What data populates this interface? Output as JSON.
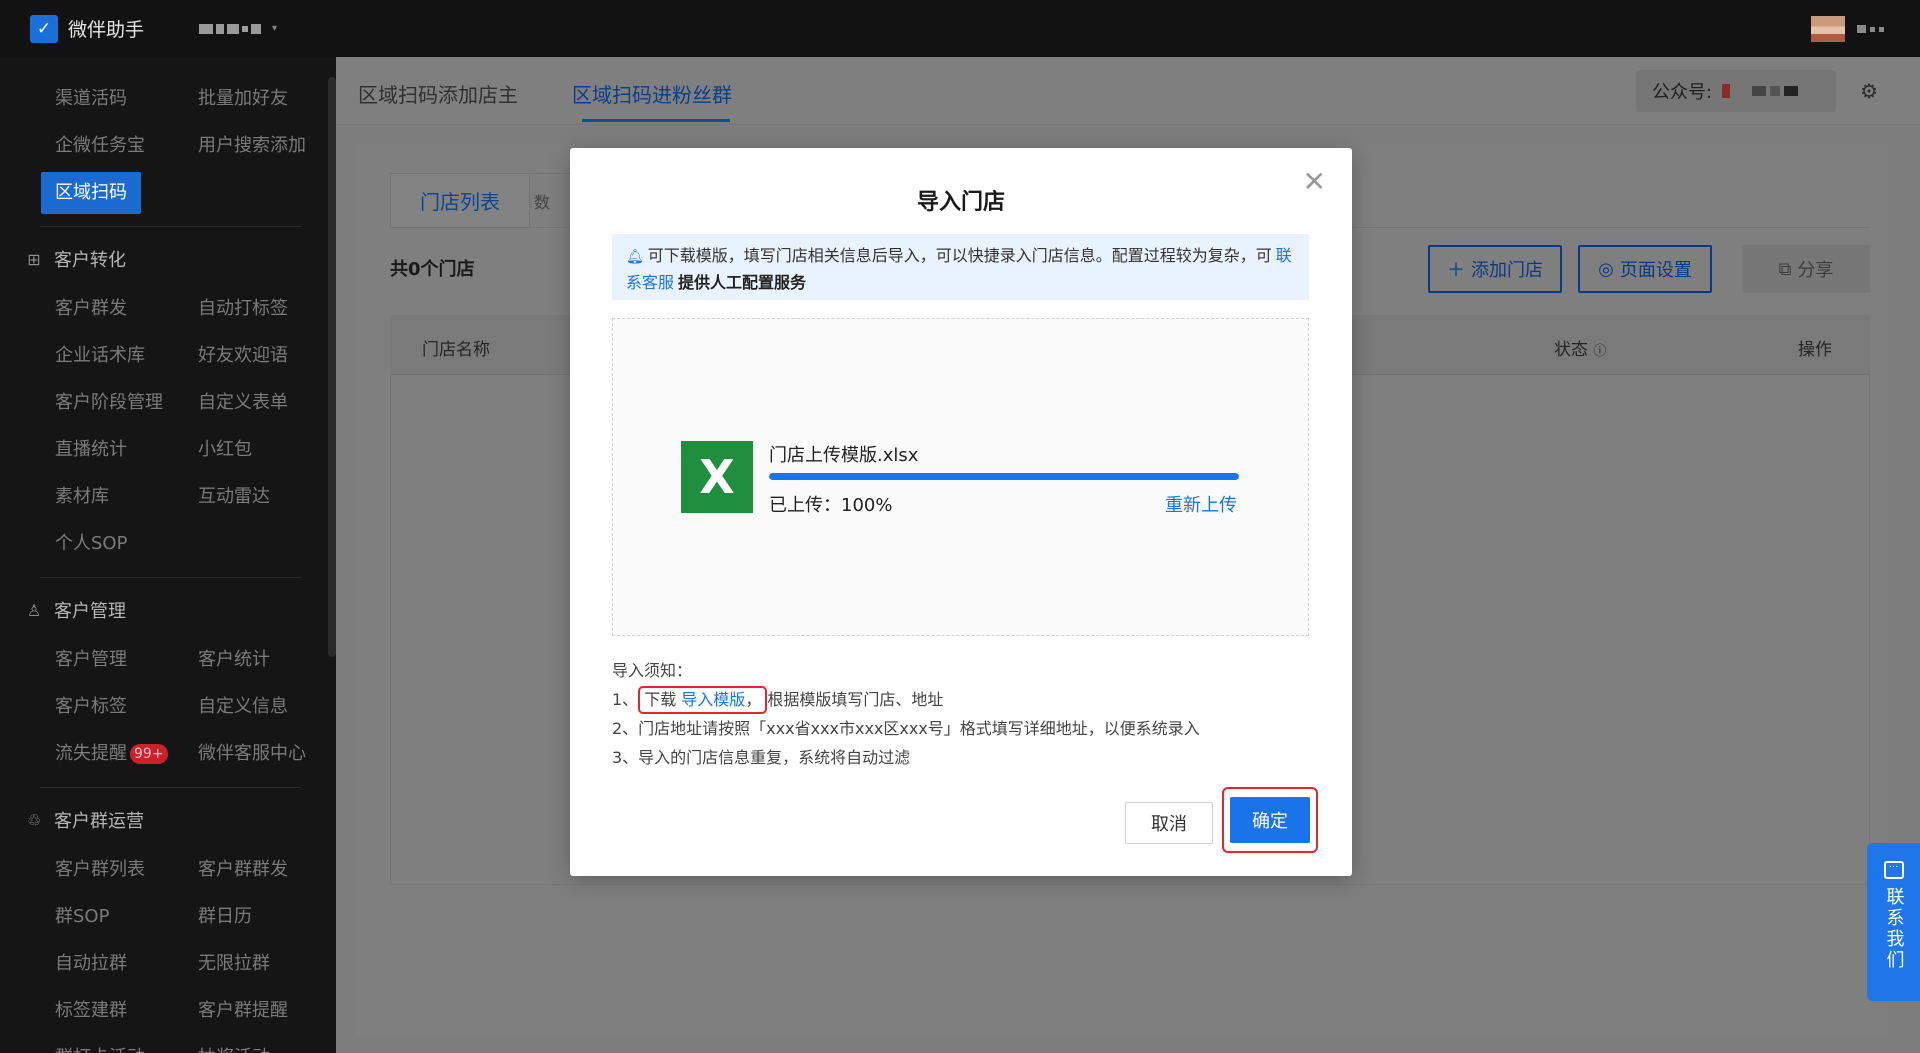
{
  "app": {
    "name": "微伴助手",
    "logo_glyph": "✓",
    "brand_color": "#1a6fd8"
  },
  "sidebar": {
    "top_items": [
      {
        "label": "渠道活码"
      },
      {
        "label": "批量加好友"
      },
      {
        "label": "企微任务宝"
      },
      {
        "label": "用户搜索添加"
      },
      {
        "label": "区域扫码",
        "active": true
      }
    ],
    "sections": [
      {
        "title": "客户转化",
        "icon": "layout-icon",
        "items": [
          "客户群发",
          "自动打标签",
          "企业话术库",
          "好友欢迎语",
          "客户阶段管理",
          "自定义表单",
          "直播统计",
          "小红包",
          "素材库",
          "互动雷达",
          "个人SOP"
        ]
      },
      {
        "title": "客户管理",
        "icon": "user-icon",
        "items": [
          "客户管理",
          "客户统计",
          "客户标签",
          "自定义信息",
          "流失提醒",
          "微伴客服中心"
        ],
        "badge": "99+"
      },
      {
        "title": "客户群运营",
        "icon": "group-icon",
        "items": [
          "客户群列表",
          "客户群群发",
          "群SOP",
          "群日历",
          "自动拉群",
          "无限拉群",
          "标签建群",
          "客户群提醒",
          "群打卡活动",
          "抽奖活动"
        ]
      }
    ]
  },
  "main": {
    "tabs": [
      {
        "label": "区域扫码添加店主"
      },
      {
        "label": "区域扫码进粉丝群",
        "active": true
      }
    ],
    "account_label": "公众号:",
    "card": {
      "tabs": [
        {
          "label": "门店列表"
        },
        {
          "label": "数"
        }
      ],
      "count_text": "共0个门店",
      "buttons": {
        "add_store": "添加门店",
        "page_settings": "页面设置",
        "share": "分享"
      },
      "columns": {
        "name": "门店名称",
        "status": "状态",
        "actions": "操作"
      }
    }
  },
  "modal": {
    "title": "导入门店",
    "notice": {
      "text_before": "可下载模版，填写门店相关信息后导入，可以快捷录入门店信息。配置过程较为复杂，可",
      "link": "联系客服",
      "text_strong": "提供人工配置服务"
    },
    "file": {
      "name": "门店上传模版.xlsx",
      "icon_letter": "X",
      "progress": 100,
      "status_text": "已上传：100%",
      "reupload": "重新上传"
    },
    "tips": {
      "title": "导入须知：",
      "line1_prefix": "1、",
      "line1_highlight_text": "下载",
      "line1_link": "导入模版",
      "line1_comma": "，",
      "line1_rest": "根据模版填写门店、地址",
      "line2": "2、门店地址请按照「xxx省xxx市xxx区xxx号」格式填写详细地址，以便系统录入",
      "line3": "3、导入的门店信息重复，系统将自动过滤"
    },
    "cancel": "取消",
    "confirm": "确定"
  },
  "float_contact": {
    "label": "联系我们"
  }
}
